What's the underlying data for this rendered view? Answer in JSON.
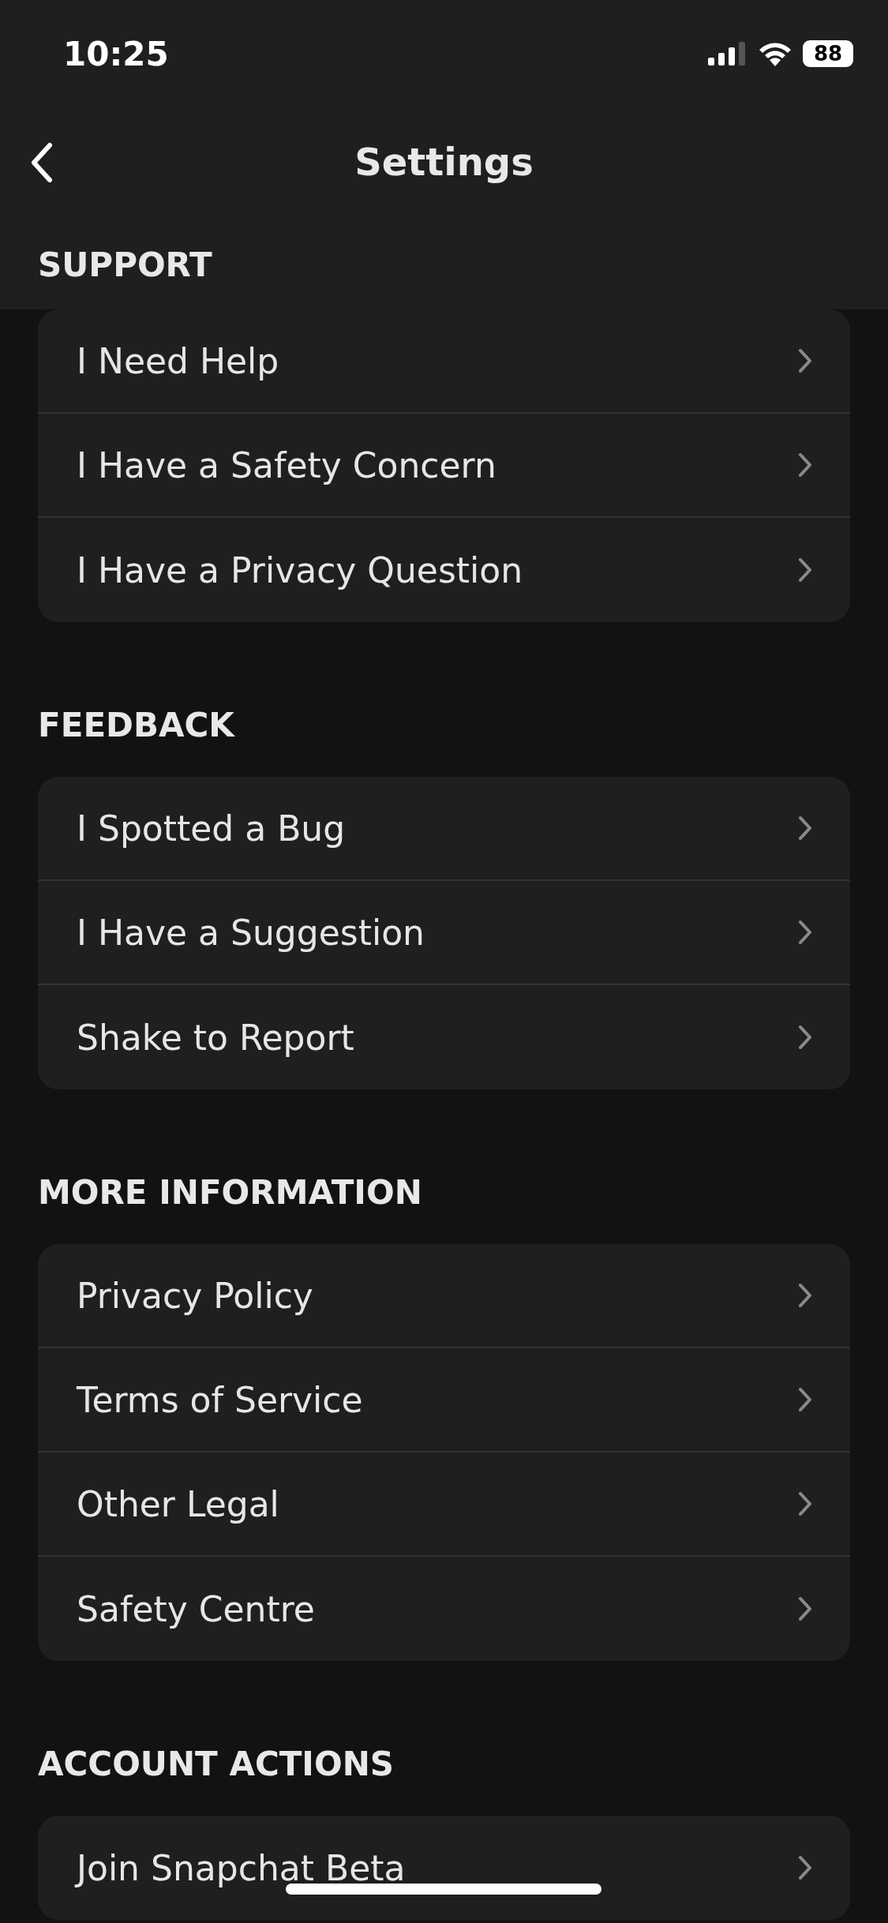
{
  "status_bar": {
    "time": "10:25",
    "battery": "88"
  },
  "nav": {
    "title": "Settings"
  },
  "sections": [
    {
      "title": "SUPPORT",
      "items": [
        {
          "label": "I Need Help"
        },
        {
          "label": "I Have a Safety Concern"
        },
        {
          "label": "I Have a Privacy Question"
        }
      ]
    },
    {
      "title": "FEEDBACK",
      "items": [
        {
          "label": "I Spotted a Bug"
        },
        {
          "label": "I Have a Suggestion"
        },
        {
          "label": "Shake to Report"
        }
      ]
    },
    {
      "title": "MORE INFORMATION",
      "items": [
        {
          "label": "Privacy Policy"
        },
        {
          "label": "Terms of Service"
        },
        {
          "label": "Other Legal"
        },
        {
          "label": "Safety Centre"
        }
      ]
    },
    {
      "title": "ACCOUNT ACTIONS",
      "items": [
        {
          "label": "Join Snapchat Beta"
        }
      ]
    }
  ]
}
